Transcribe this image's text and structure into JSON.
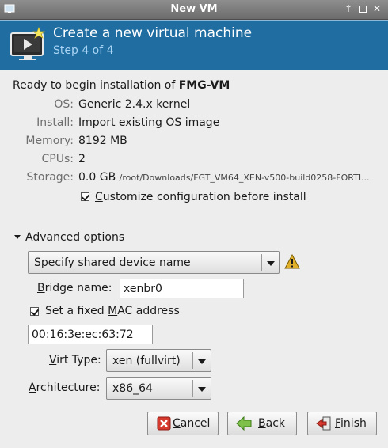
{
  "window": {
    "title": "New VM"
  },
  "header": {
    "title": "Create a new virtual machine",
    "step": "Step 4 of 4"
  },
  "summary": {
    "ready_prefix": "Ready to begin installation of ",
    "vm_name": "FMG-VM",
    "os_label": "OS:",
    "os_value": "Generic 2.4.x kernel",
    "install_label": "Install:",
    "install_value": "Import existing OS image",
    "memory_label": "Memory:",
    "memory_value": "8192 MB",
    "cpus_label": "CPUs:",
    "cpus_value": "2",
    "storage_label": "Storage:",
    "storage_size": "0.0 GB",
    "storage_path": "/root/Downloads/FGT_VM64_XEN-v500-build0258-FORTI...",
    "customize_pre": "",
    "customize_mnemonic": "C",
    "customize_post": "ustomize configuration before install",
    "customize_checked": true
  },
  "advanced": {
    "expander_label": "Advanced options",
    "network_source": "Specify shared device name",
    "warning_icon": "warning-icon",
    "bridge_mnemonic": "B",
    "bridge_label_rest": "ridge name:",
    "bridge_value": "xenbr0",
    "mac_pre": "Set a fixed ",
    "mac_mnemonic": "M",
    "mac_post": "AC address",
    "mac_checked": true,
    "mac_value": "00:16:3e:ec:63:72",
    "virt_type_mnemonic": "V",
    "virt_type_label_rest": "irt Type:",
    "virt_type_value": "xen (fullvirt)",
    "arch_mnemonic": "A",
    "arch_label_rest": "rchitecture:",
    "arch_value": "x86_64"
  },
  "buttons": {
    "cancel_mnemonic": "C",
    "cancel_rest": "ancel",
    "back_mnemonic": "B",
    "back_rest": "ack",
    "finish_mnemonic": "F",
    "finish_rest": "inish"
  },
  "colors": {
    "header_bg": "#1f6da1",
    "step_text": "#a9d4f3",
    "warning": "#e2b12a"
  }
}
